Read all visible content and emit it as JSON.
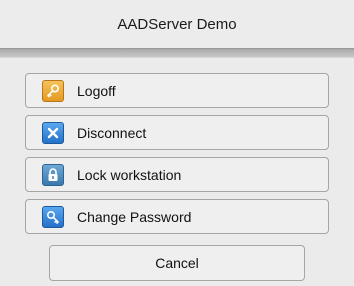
{
  "window": {
    "title": "AADServer Demo"
  },
  "actions": [
    {
      "label": "Logoff",
      "icon": "key-icon"
    },
    {
      "label": "Disconnect",
      "icon": "close-icon"
    },
    {
      "label": "Lock workstation",
      "icon": "lock-icon"
    },
    {
      "label": "Change Password",
      "icon": "password-key-icon"
    }
  ],
  "cancel": {
    "label": "Cancel"
  }
}
